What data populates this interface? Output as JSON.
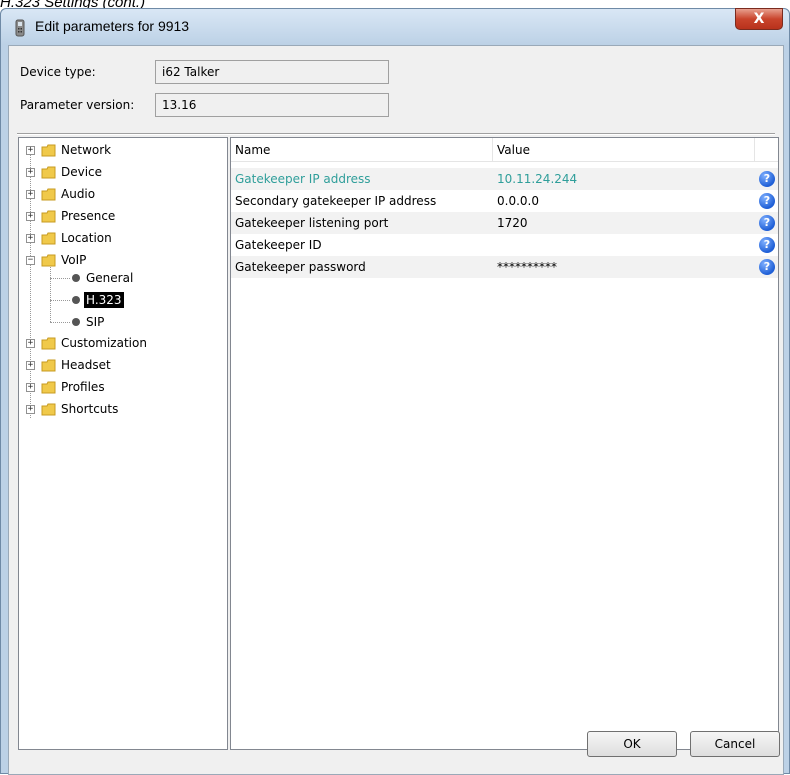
{
  "doc_caption": "H.323 Settings (cont.)",
  "window": {
    "title": "Edit parameters for 9913",
    "close_glyph": "X"
  },
  "fields": {
    "device_type_label": "Device type:",
    "device_type_value": "i62 Talker",
    "parameter_version_label": "Parameter version:",
    "parameter_version_value": "13.16"
  },
  "tree": {
    "expand_glyph": "+",
    "collapse_glyph": "−",
    "items": [
      {
        "label": "Network"
      },
      {
        "label": "Device"
      },
      {
        "label": "Audio"
      },
      {
        "label": "Presence"
      },
      {
        "label": "Location"
      },
      {
        "label": "VoIP"
      },
      {
        "label": "General"
      },
      {
        "label": "H.323"
      },
      {
        "label": "SIP"
      },
      {
        "label": "Customization"
      },
      {
        "label": "Headset"
      },
      {
        "label": "Profiles"
      },
      {
        "label": "Shortcuts"
      }
    ]
  },
  "table": {
    "headers": {
      "name": "Name",
      "value": "Value"
    },
    "help_glyph": "?",
    "rows": [
      {
        "name": "Gatekeeper IP address",
        "value": "10.11.24.244"
      },
      {
        "name": "Secondary gatekeeper IP address",
        "value": "0.0.0.0"
      },
      {
        "name": "Gatekeeper listening port",
        "value": "1720"
      },
      {
        "name": "Gatekeeper ID",
        "value": ""
      },
      {
        "name": "Gatekeeper password",
        "value": "**********"
      }
    ]
  },
  "buttons": {
    "ok": "OK",
    "cancel": "Cancel"
  },
  "colors": {
    "highlight_text": "#2f9e9a",
    "selected_bg": "#000000",
    "window_frame": "#bcd1e6",
    "close_button": "#c9442c",
    "help_icon": "#1f5fd6"
  }
}
